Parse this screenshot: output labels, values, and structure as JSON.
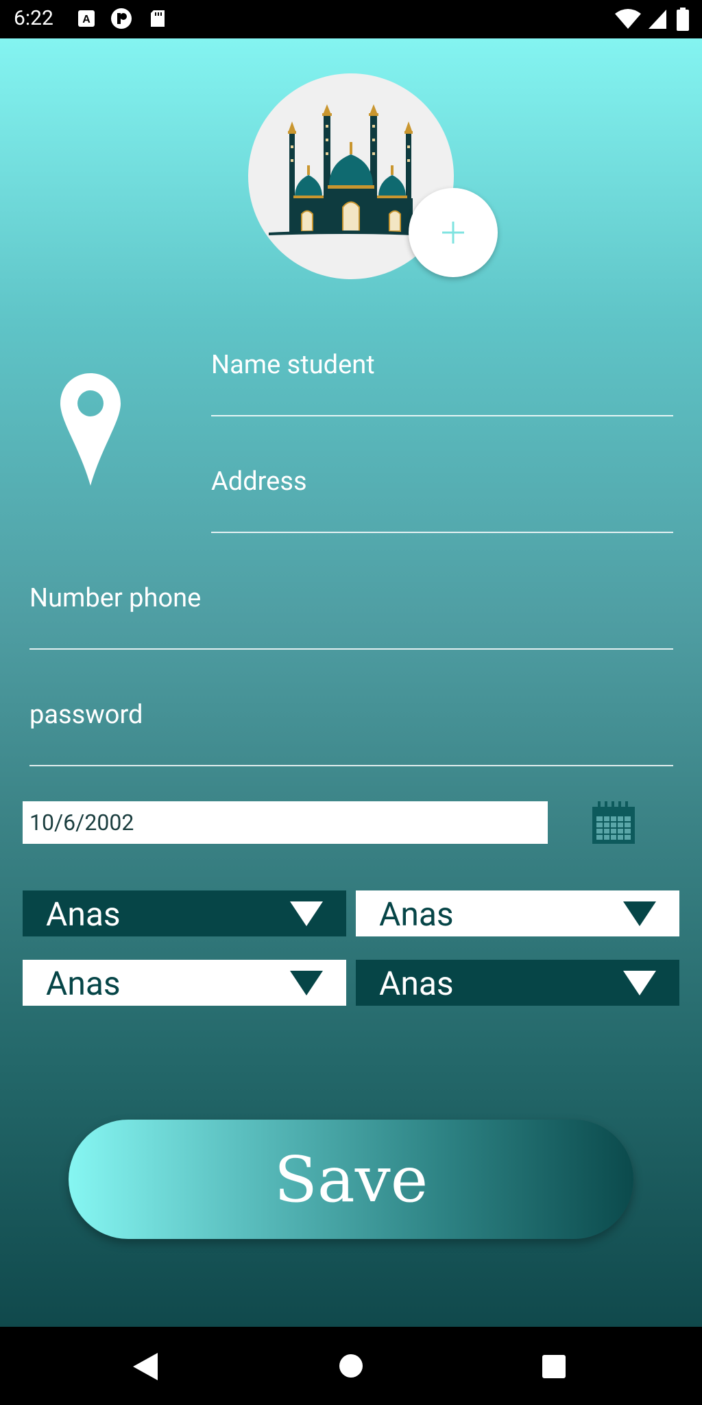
{
  "status_bar": {
    "time": "6:22"
  },
  "form": {
    "name_placeholder": "Name student",
    "address_placeholder": "Address",
    "phone_placeholder": "Number phone",
    "password_placeholder": "password",
    "date_value": "10/6/2002"
  },
  "dropdowns": [
    {
      "value": "Anas",
      "style": "dark"
    },
    {
      "value": "Anas",
      "style": "light"
    },
    {
      "value": "Anas",
      "style": "light"
    },
    {
      "value": "Anas",
      "style": "dark"
    }
  ],
  "save_label": "Save",
  "icons": {
    "avatar": "mosque-image",
    "add": "plus-icon",
    "location": "location-pin-icon",
    "calendar": "calendar-icon",
    "nav_back": "back-triangle-icon",
    "nav_home": "home-circle-icon",
    "nav_recents": "recents-square-icon"
  },
  "colors": {
    "dark_teal": "#064547",
    "accent_cyan": "#84f4f1",
    "plus": "#7fe3e0"
  }
}
